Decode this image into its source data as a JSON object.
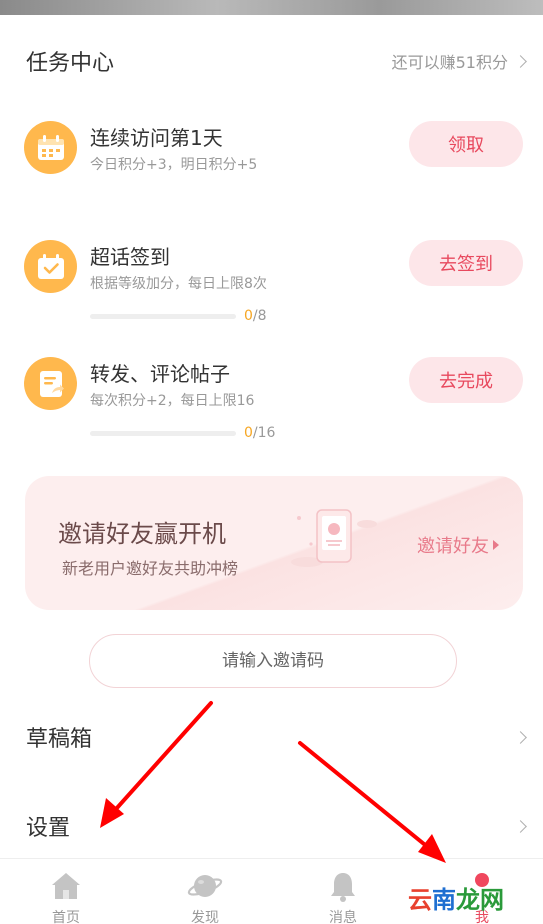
{
  "header": {
    "title": "任务中心",
    "more": "还可以赚51积分"
  },
  "tasks": [
    {
      "name": "连续访问第1天",
      "desc": "今日积分+3，明日积分+5",
      "button": "领取",
      "icon": "calendar-icon"
    },
    {
      "name": "超话签到",
      "desc": "根据等级加分，每日上限8次",
      "button": "去签到",
      "icon": "checkin-icon",
      "progress_current": "0",
      "progress_total": "/8"
    },
    {
      "name": "转发、评论帖子",
      "desc": "每次积分+2，每日上限16",
      "button": "去完成",
      "icon": "document-share-icon",
      "progress_current": "0",
      "progress_total": "/16"
    }
  ],
  "invite": {
    "title": "邀请好友赢开机",
    "subtitle": "新老用户邀好友共助冲榜",
    "button": "邀请好友"
  },
  "invite_code": {
    "placeholder": "请输入邀请码"
  },
  "menu": [
    {
      "label": "草稿箱"
    },
    {
      "label": "设置"
    }
  ],
  "tabbar": [
    {
      "label": "首页",
      "icon": "home-icon"
    },
    {
      "label": "发现",
      "icon": "planet-icon"
    },
    {
      "label": "消息",
      "icon": "bell-icon"
    },
    {
      "label": "我",
      "icon": "profile-icon"
    }
  ],
  "watermark": {
    "part1": "云",
    "part2": "南",
    "part3": "龙网"
  },
  "colors": {
    "accent": "#e8495e",
    "icon_bg": "#ffb84d",
    "button_bg": "#fde6e9",
    "progress": "#f6a623",
    "annotation_arrow": "#ff0000"
  }
}
